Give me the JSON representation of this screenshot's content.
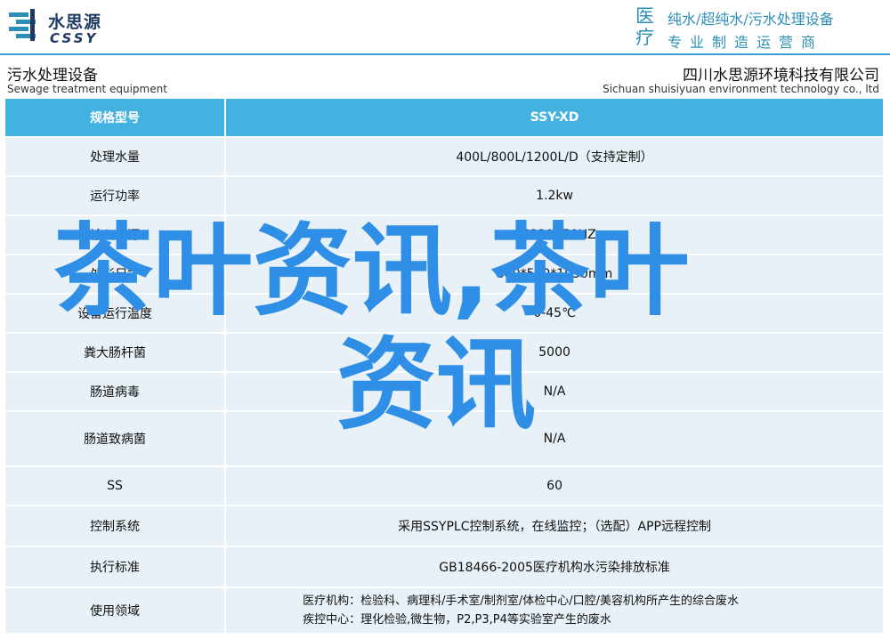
{
  "header": {
    "brand_cn": "水思源",
    "brand_en": "CSSY",
    "tagline_big": "医疗",
    "tagline_line1": "纯水/超纯水/污水处理设备",
    "tagline_line2": "专业制造运营商",
    "accent_color": "#2e8fb6"
  },
  "title_band": {
    "left_cn": "污水处理设备",
    "left_en": "Sewage treatment equipment",
    "right_cn": "四川水思源环境科技有限公司",
    "right_en": "Sichuan shuisiyuan environment technology co., ltd"
  },
  "table": {
    "header": {
      "label": "规格型号",
      "value": "SSY-XD"
    },
    "rows": [
      {
        "label": "处理水量",
        "value": "400L/800L/1200L/D（支持定制）"
      },
      {
        "label": "运行功率",
        "value": "1.2kw"
      },
      {
        "label": "输入电源",
        "value": "AC220V50HZ"
      },
      {
        "label": "外形尺寸",
        "value": "680*560*1050mm"
      },
      {
        "label": "设备运行温度",
        "value": "0-45℃"
      },
      {
        "label": "粪大肠杆菌",
        "value": "5000"
      },
      {
        "label": "肠道病毒",
        "value": "N/A"
      },
      {
        "label": "肠道致病菌",
        "value": "N/A"
      },
      {
        "label": "SS",
        "value": "60"
      },
      {
        "label": "控制系统",
        "value": "采用SSYPLC控制系统，在线监控；（选配）APP远程控制"
      },
      {
        "label": "执行标准",
        "value": "GB18466-2005医疗机构水污染排放标准"
      },
      {
        "label": "使用领域",
        "value_line1": "医疗机构：检验科、病理科/手术室/制剂室/体检中心/口腔/美容机构所产生的综合废水",
        "value_line2": "疾控中心：理化检验,微生物，P2,P3,P4等实验室产生的废水"
      }
    ],
    "header_color": "#44b2e0",
    "row_color": "#e8f1f7"
  },
  "watermark": {
    "line1": "茶叶资讯,茶叶",
    "line2": "资讯",
    "color": "#2f8fe6"
  }
}
